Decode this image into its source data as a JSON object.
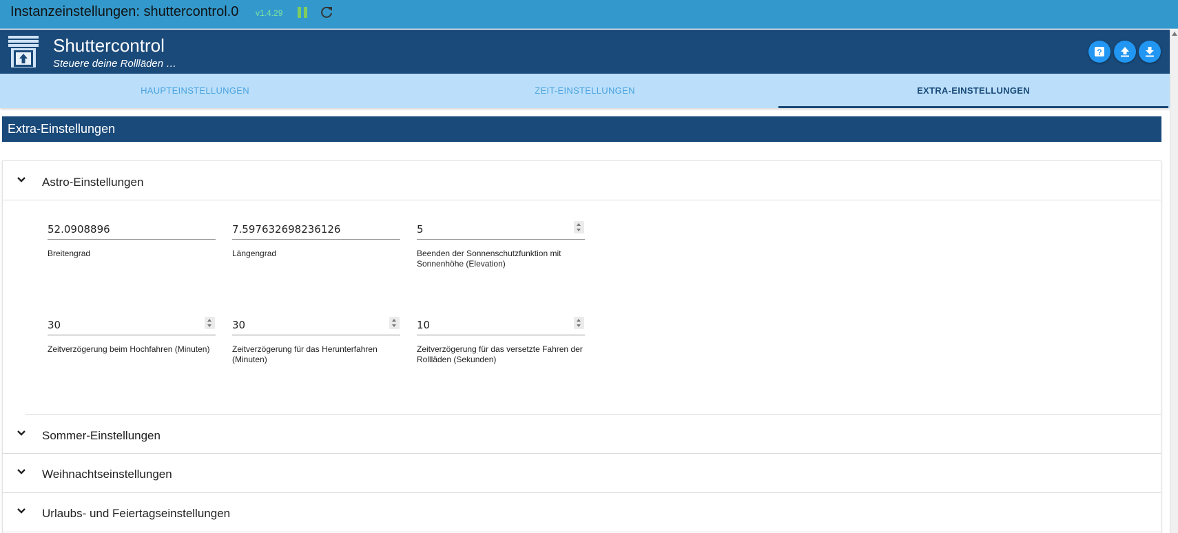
{
  "window": {
    "title": "Instanzeinstellungen: shuttercontrol.0",
    "version": "v1.4.29"
  },
  "header": {
    "title": "Shuttercontrol",
    "subtitle": "Steuere deine Rollläden …",
    "logo_icon": "shutter-logo-icon",
    "buttons": [
      {
        "icon": "help-icon"
      },
      {
        "icon": "upload-icon"
      },
      {
        "icon": "download-icon"
      }
    ]
  },
  "tabs": [
    {
      "label": "HAUPTEINSTELLUNGEN",
      "active": false
    },
    {
      "label": "ZEIT-EINSTELLUNGEN",
      "active": false
    },
    {
      "label": "EXTRA-EINSTELLUNGEN",
      "active": true
    }
  ],
  "section": {
    "title": "Extra-Einstellungen"
  },
  "accordion": {
    "astro": {
      "title": "Astro-Einstellungen",
      "fields": [
        {
          "value": "52.0908896",
          "label": "Breitengrad"
        },
        {
          "value": "7.597632698236126",
          "label": "Längengrad"
        },
        {
          "value": "5",
          "label": "Beenden der Sonnenschutzfunktion mit Sonnenhöhe (Elevation)"
        },
        {
          "value": "30",
          "label": "Zeitverzögerung beim Hochfahren (Minuten)"
        },
        {
          "value": "30",
          "label": "Zeitverzögerung für das Herunterfahren (Minuten)"
        },
        {
          "value": "10",
          "label": "Zeitverzögerung für das versetzte Fahren der Rollläden (Sekunden)"
        }
      ]
    },
    "sommer": {
      "title": "Sommer-Einstellungen"
    },
    "weihnacht": {
      "title": "Weihnachtseinstellungen"
    },
    "urlaub": {
      "title": "Urlaubs- und Feiertagseinstellungen"
    }
  },
  "colors": {
    "titlebar": "#3399cc",
    "header": "#1a4a7a",
    "tabs": "#bbdffa",
    "accent": "#2196f3"
  }
}
